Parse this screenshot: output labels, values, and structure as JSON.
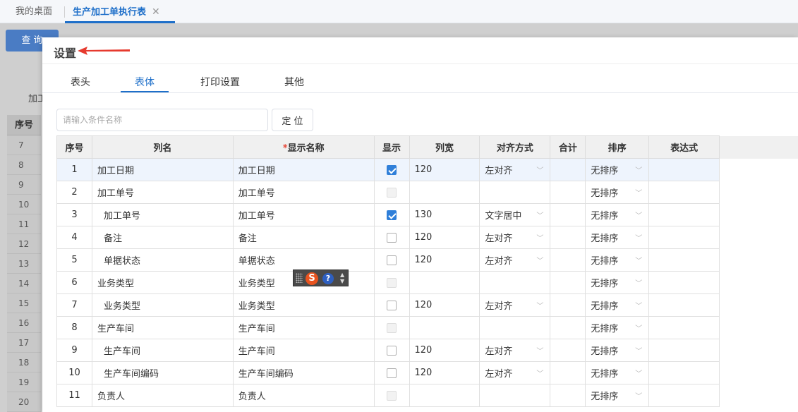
{
  "top_tabs": [
    {
      "label": "我的桌面"
    },
    {
      "label": "生产加工单执行表",
      "close": "✕"
    }
  ],
  "background": {
    "query_button": "查 询",
    "filter_label": "加工",
    "index_header": "序号",
    "index_rows": [
      "7",
      "8",
      "9",
      "10",
      "11",
      "12",
      "13",
      "14",
      "15",
      "16",
      "17",
      "18",
      "19",
      "20"
    ]
  },
  "dialog": {
    "title": "设置",
    "tabs": [
      "表头",
      "表体",
      "打印设置",
      "其他"
    ],
    "active_tab": "表体",
    "search": {
      "placeholder": "请输入条件名称",
      "value": ""
    },
    "locate_button": "定 位",
    "columns": {
      "index": "序号",
      "name": "列名",
      "display_required": "*",
      "display_name": "显示名称",
      "show": "显示",
      "width": "列宽",
      "align": "对齐方式",
      "sum": "合计",
      "sort": "排序",
      "expr": "表达式"
    },
    "rows": [
      {
        "idx": "1",
        "name": "加工日期",
        "display": "加工日期",
        "show": "checked",
        "width": "120",
        "width_muted": false,
        "align": "左对齐",
        "sort": "无排序",
        "indent": false,
        "selected": true
      },
      {
        "idx": "2",
        "name": "加工单号",
        "display": "加工单号",
        "show": "disabled",
        "width": "",
        "width_muted": false,
        "align": "",
        "sort": "无排序",
        "indent": false,
        "selected": false
      },
      {
        "idx": "3",
        "name": "加工单号",
        "display": "加工单号",
        "show": "checked",
        "width": "130",
        "width_muted": false,
        "align": "文字居中",
        "sort": "无排序",
        "indent": true,
        "selected": false
      },
      {
        "idx": "4",
        "name": "备注",
        "display": "备注",
        "show": "unchecked",
        "width": "120",
        "width_muted": true,
        "align": "左对齐",
        "sort": "无排序",
        "indent": true,
        "selected": false
      },
      {
        "idx": "5",
        "name": "单据状态",
        "display": "单据状态",
        "show": "unchecked",
        "width": "120",
        "width_muted": true,
        "align": "左对齐",
        "sort": "无排序",
        "indent": true,
        "selected": false
      },
      {
        "idx": "6",
        "name": "业务类型",
        "display": "业务类型",
        "show": "disabled",
        "width": "",
        "width_muted": false,
        "align": "",
        "sort": "无排序",
        "indent": false,
        "selected": false
      },
      {
        "idx": "7",
        "name": "业务类型",
        "display": "业务类型",
        "show": "unchecked",
        "width": "120",
        "width_muted": true,
        "align": "左对齐",
        "sort": "无排序",
        "indent": true,
        "selected": false
      },
      {
        "idx": "8",
        "name": "生产车间",
        "display": "生产车间",
        "show": "disabled",
        "width": "",
        "width_muted": false,
        "align": "",
        "sort": "无排序",
        "indent": false,
        "selected": false
      },
      {
        "idx": "9",
        "name": "生产车间",
        "display": "生产车间",
        "show": "unchecked",
        "width": "120",
        "width_muted": true,
        "align": "左对齐",
        "sort": "无排序",
        "indent": true,
        "selected": false
      },
      {
        "idx": "10",
        "name": "生产车间编码",
        "display": "生产车间编码",
        "show": "unchecked",
        "width": "120",
        "width_muted": true,
        "align": "左对齐",
        "sort": "无排序",
        "indent": true,
        "selected": false
      },
      {
        "idx": "11",
        "name": "负责人",
        "display": "负责人",
        "show": "disabled",
        "width": "",
        "width_muted": false,
        "align": "",
        "sort": "无排序",
        "indent": false,
        "selected": false
      }
    ]
  },
  "ime_toolbar": {
    "logo": "S",
    "help": "?"
  },
  "colors": {
    "accent": "#1e6fc9",
    "checkbox": "#2f7fd9",
    "arrow": "#e63a2e"
  }
}
